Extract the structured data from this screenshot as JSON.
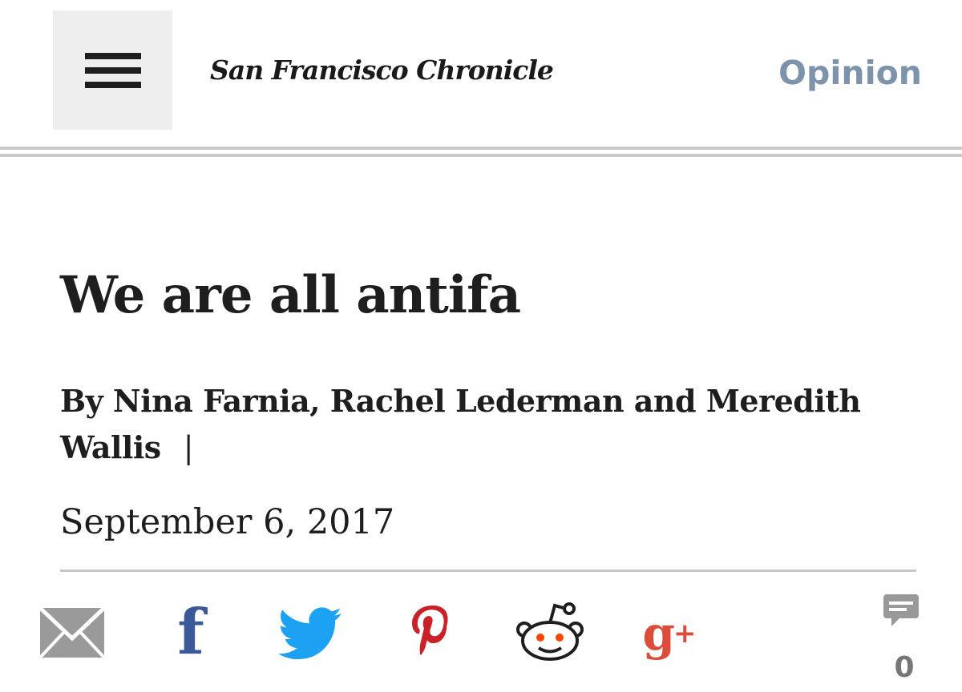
{
  "header": {
    "masthead": "San Francisco Chronicle",
    "section": "Opinion",
    "menu_icon": "hamburger-menu-icon"
  },
  "article": {
    "headline": "We are all antifa",
    "byline": "By Nina Farnia, Rachel Lederman and Meredith Wallis",
    "byline_separator": "|",
    "date": "September 6, 2017"
  },
  "share": {
    "icons": [
      "email-icon",
      "facebook-icon",
      "twitter-icon",
      "pinterest-icon",
      "reddit-icon",
      "google-plus-icon",
      "comment-icon"
    ],
    "facebook_glyph": "f",
    "google_glyph": "g",
    "google_plus": "+",
    "comment_count": "0"
  },
  "colors": {
    "section_link": "#7c93ab",
    "facebook": "#3b5998",
    "twitter": "#1da1f2",
    "pinterest": "#cb2027",
    "reddit_eyes": "#ff4500",
    "google_plus": "#dd4b39",
    "icon_gray": "#999999"
  }
}
